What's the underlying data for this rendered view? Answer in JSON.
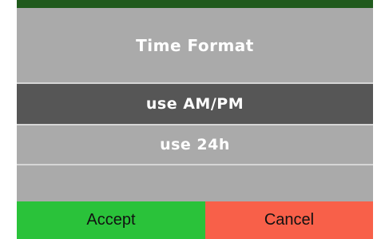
{
  "dialog": {
    "title": "Time Format",
    "options": [
      {
        "label": "use AM/PM",
        "selected": true
      },
      {
        "label": "use 24h",
        "selected": false
      }
    ]
  },
  "buttons": {
    "accept_label": "Accept",
    "cancel_label": "Cancel"
  },
  "colors": {
    "dialog_bg": "#aaaaaa",
    "selected_option_bg": "#565656",
    "accept_bg": "#2ac23a",
    "cancel_bg": "#f86049"
  }
}
